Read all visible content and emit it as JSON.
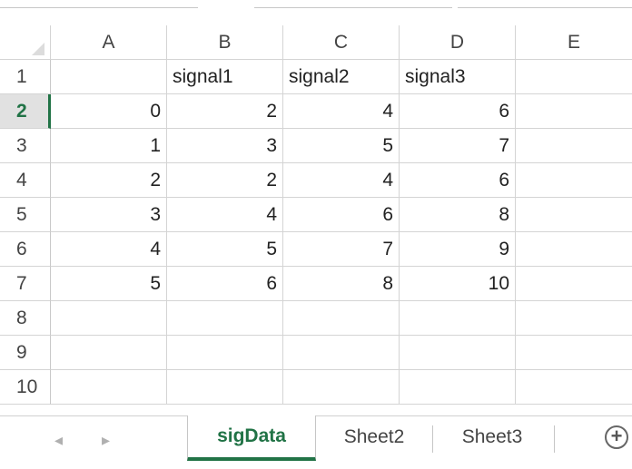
{
  "window": {
    "title": ""
  },
  "columns": [
    "A",
    "B",
    "C",
    "D",
    "E"
  ],
  "rows": [
    {
      "num": "1",
      "cells": [
        "",
        "signal1",
        "signal2",
        "signal3",
        ""
      ]
    },
    {
      "num": "2",
      "cells": [
        "0",
        "2",
        "4",
        "6",
        ""
      ]
    },
    {
      "num": "3",
      "cells": [
        "1",
        "3",
        "5",
        "7",
        ""
      ]
    },
    {
      "num": "4",
      "cells": [
        "2",
        "2",
        "4",
        "6",
        ""
      ]
    },
    {
      "num": "5",
      "cells": [
        "3",
        "4",
        "6",
        "8",
        ""
      ]
    },
    {
      "num": "6",
      "cells": [
        "4",
        "5",
        "7",
        "9",
        ""
      ]
    },
    {
      "num": "7",
      "cells": [
        "5",
        "6",
        "8",
        "10",
        ""
      ]
    },
    {
      "num": "8",
      "cells": [
        "",
        "",
        "",
        "",
        ""
      ]
    },
    {
      "num": "9",
      "cells": [
        "",
        "",
        "",
        "",
        ""
      ]
    },
    {
      "num": "10",
      "cells": [
        "",
        "",
        "",
        "",
        ""
      ]
    }
  ],
  "active_row": "2",
  "sheets": [
    {
      "label": "sigData",
      "active": true
    },
    {
      "label": "Sheet2",
      "active": false
    },
    {
      "label": "Sheet3",
      "active": false
    }
  ],
  "nav": {
    "prev_glyph": "◂",
    "next_glyph": "▸"
  },
  "add_sheet_glyph": "+",
  "colors": {
    "accent": "#217346",
    "gridline": "#d4d4d4"
  }
}
